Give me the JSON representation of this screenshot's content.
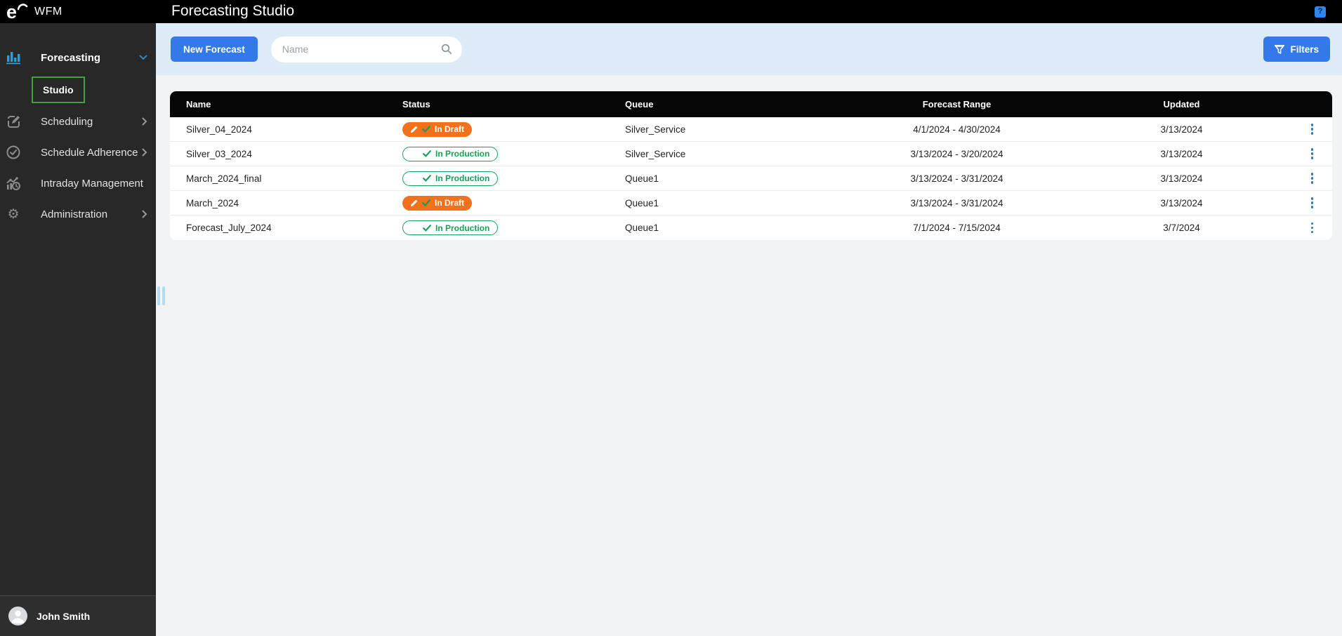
{
  "topbar": {
    "brand": "WFM",
    "title": "Forecasting Studio",
    "help_icon": "?"
  },
  "sidebar": {
    "items": [
      {
        "label": "Forecasting",
        "icon": "bar-chart-icon",
        "state": "expanded-active"
      },
      {
        "label": "Studio",
        "icon": "",
        "state": "selected-subitem"
      },
      {
        "label": "Scheduling",
        "icon": "edit-icon",
        "state": "collapsed"
      },
      {
        "label": "Schedule Adherence",
        "icon": "check-circle-icon",
        "state": "collapsed"
      },
      {
        "label": "Intraday Management",
        "icon": "intraday-chart-clock-icon",
        "state": "none"
      },
      {
        "label": "Administration",
        "icon": "gear-icon",
        "state": "collapsed"
      }
    ],
    "gear_glyph": "⚙",
    "user_name": "John Smith"
  },
  "toolbar": {
    "new_forecast": "New Forecast",
    "search_placeholder": "Name",
    "filters": "Filters"
  },
  "table": {
    "columns": [
      "Name",
      "Status",
      "Queue",
      "Forecast Range",
      "Updated"
    ],
    "rows": [
      {
        "name": "Silver_04_2024",
        "status": "In Draft",
        "queue": "Silver_Service",
        "range": "4/1/2024 - 4/30/2024",
        "updated": "3/13/2024"
      },
      {
        "name": "Silver_03_2024",
        "status": "In Production",
        "queue": "Silver_Service",
        "range": "3/13/2024 - 3/20/2024",
        "updated": "3/13/2024"
      },
      {
        "name": "March_2024_final",
        "status": "In Production",
        "queue": "Queue1",
        "range": "3/13/2024 - 3/31/2024",
        "updated": "3/13/2024"
      },
      {
        "name": "March_2024",
        "status": "In Draft",
        "queue": "Queue1",
        "range": "3/13/2024 - 3/31/2024",
        "updated": "3/13/2024"
      },
      {
        "name": "Forecast_July_2024",
        "status": "In Production",
        "queue": "Queue1",
        "range": "7/1/2024 - 7/15/2024",
        "updated": "3/7/2024"
      }
    ]
  },
  "colors": {
    "accent_blue": "#3379e8",
    "sidebar_icon_blue": "#2d9cdb",
    "kebab_blue": "#2b74c9",
    "draft_orange": "#f1711d",
    "production_green": "#14a05a",
    "selection_green": "#43a047",
    "topbar_black": "#000000",
    "sidebar_dark": "#282828",
    "toolbar_band_blue": "#dcebf7",
    "content_gray": "#f1f3f4"
  }
}
